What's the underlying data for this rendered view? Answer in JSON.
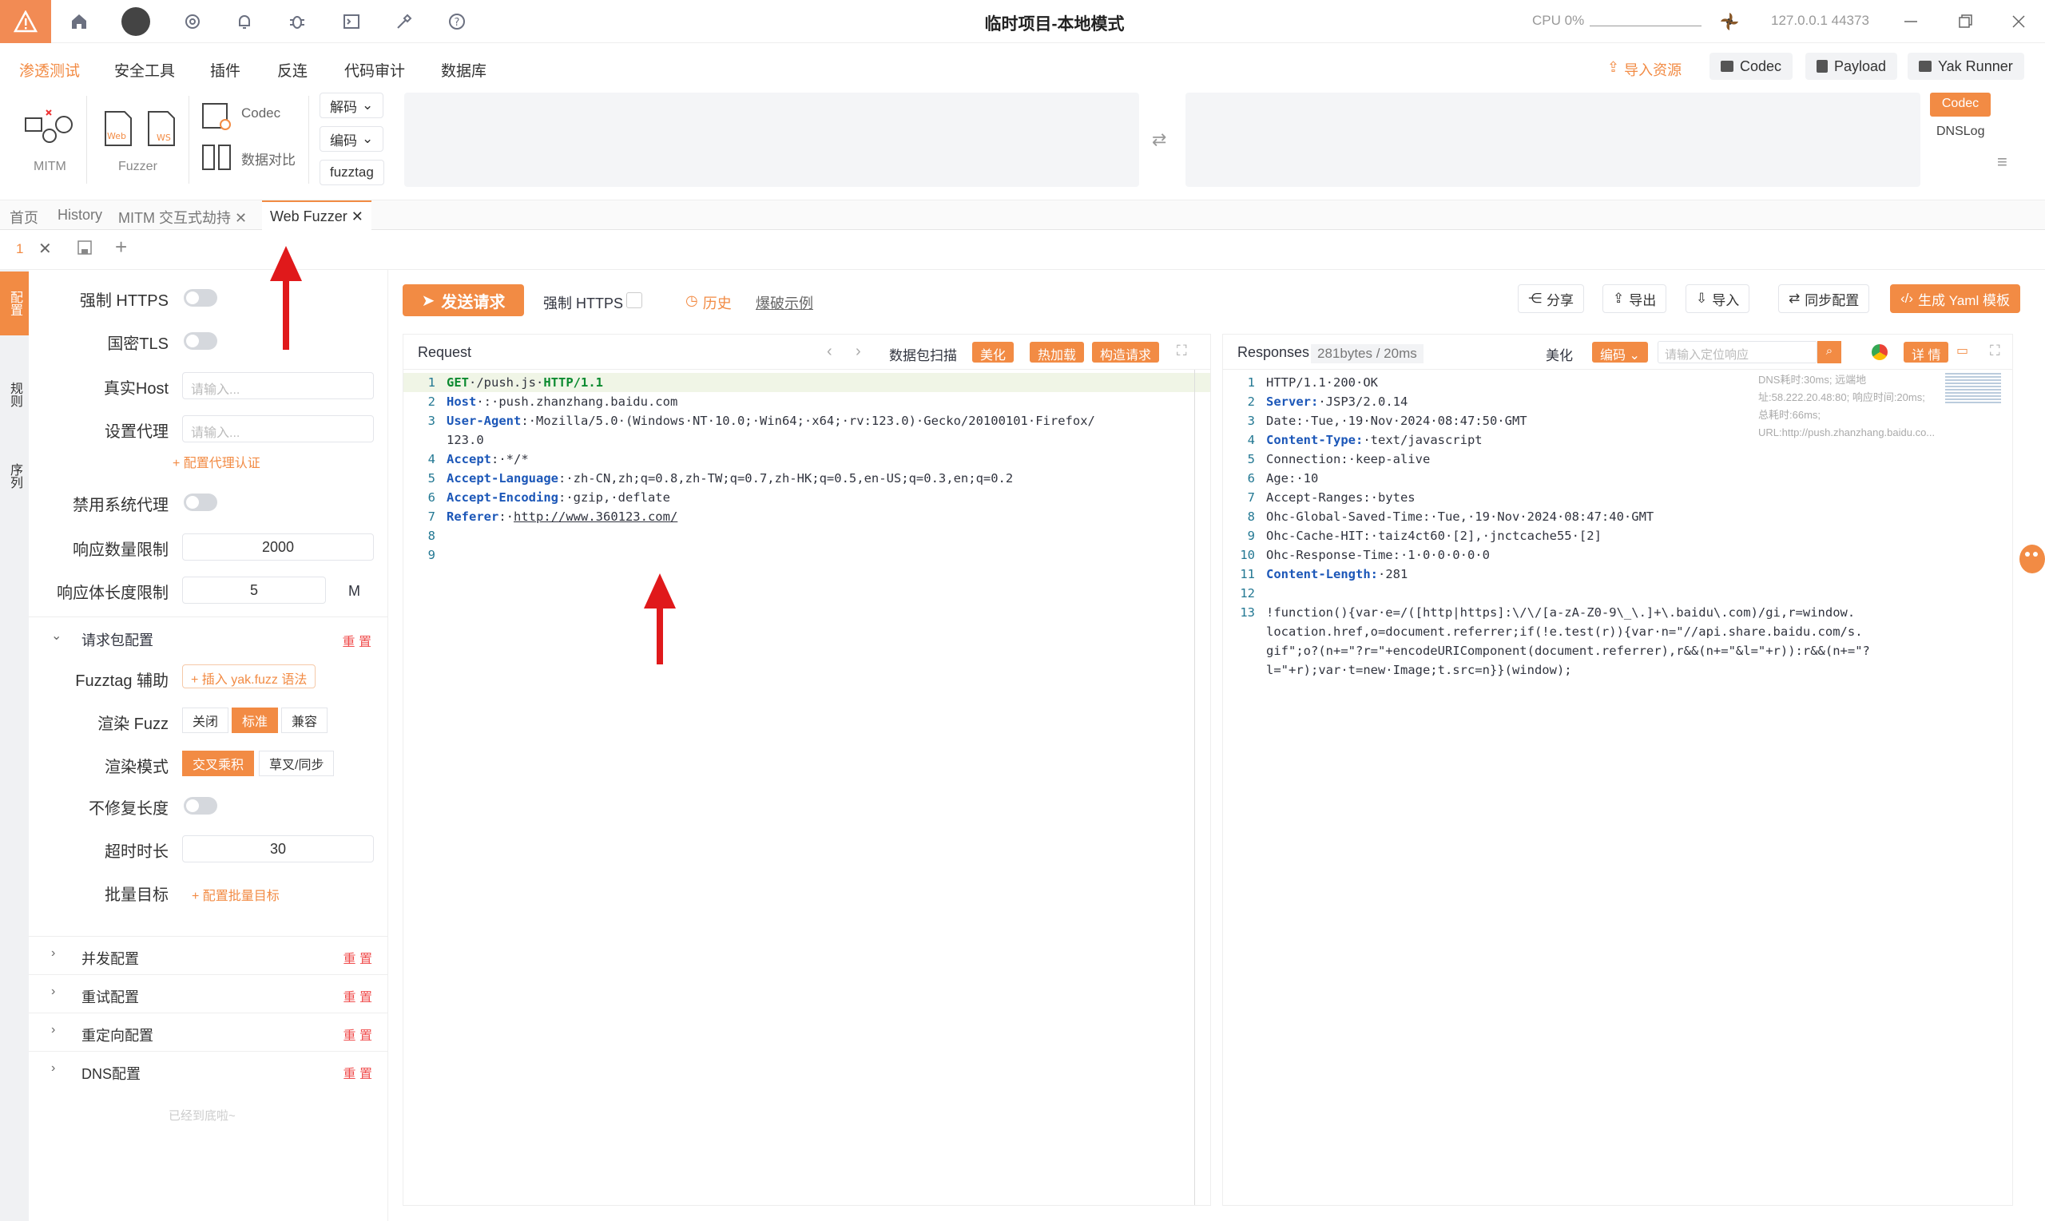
{
  "title": "临时项目-本地模式",
  "cpu": "CPU 0%",
  "ip": "127.0.0.1 44373",
  "menu": [
    "渗透测试",
    "安全工具",
    "插件",
    "反连",
    "代码审计",
    "数据库"
  ],
  "menu_right": {
    "import": "导入资源",
    "codec": "Codec",
    "payload": "Payload",
    "yak": "Yak Runner"
  },
  "tools": {
    "mitm": "MITM",
    "fuzzer": "Fuzzer",
    "codec": "Codec",
    "compare": "数据对比",
    "decode": "解码",
    "encode": "编码",
    "fuzztag": "fuzztag",
    "codec_btn": "Codec",
    "dnslog": "DNSLog"
  },
  "tabs": [
    "首页",
    "History",
    "MITM 交互式劫持",
    "Web Fuzzer"
  ],
  "subtab": "1",
  "left_strip": [
    "配置",
    "规则",
    "序列"
  ],
  "sidebar": {
    "force_https": "强制 HTTPS",
    "gm_tls": "国密TLS",
    "real_host": "真实Host",
    "real_host_ph": "请输入...",
    "proxy": "设置代理",
    "proxy_ph": "请输入...",
    "proxy_auth": "+ 配置代理认证",
    "disable_sys_proxy": "禁用系统代理",
    "resp_count": "响应数量限制",
    "resp_count_val": "2000",
    "resp_len": "响应体长度限制",
    "resp_len_val": "5",
    "resp_len_unit": "M",
    "req_cfg": "请求包配置",
    "reset": "重 置",
    "fuzztag_help": "Fuzztag 辅助",
    "fuzztag_insert": "+ 插入 yak.fuzz 语法",
    "render_fuzz": "渲染 Fuzz",
    "rf_opts": [
      "关闭",
      "标准",
      "兼容"
    ],
    "render_mode": "渲染模式",
    "rm_opts": [
      "交叉乘积",
      "草叉/同步"
    ],
    "no_fix_len": "不修复长度",
    "timeout": "超时时长",
    "timeout_val": "30",
    "batch": "批量目标",
    "batch_link": "+ 配置批量目标",
    "concurrency": "并发配置",
    "retry": "重试配置",
    "redirect": "重定向配置",
    "dns": "DNS配置",
    "bottom": "已经到底啦~"
  },
  "toolbar": {
    "send": "发送请求",
    "force_https": "强制 HTTPS",
    "history": "历史",
    "example": "爆破示例",
    "share": "分享",
    "export": "导出",
    "import": "导入",
    "sync": "同步配置",
    "yaml": "生成 Yaml 模板"
  },
  "request": {
    "title": "Request",
    "scan": "数据包扫描",
    "beautify": "美化",
    "hotload": "热加载",
    "build": "构造请求"
  },
  "response": {
    "title": "Responses",
    "stats": "281bytes / 20ms",
    "beautify": "美化",
    "encode": "编码",
    "search_ph": "请输入定位响应",
    "detail": "详 情",
    "meta": "DNS耗时:30ms; 远端地址:58.222.20.48:80; 响应时间:20ms; 总耗时:66ms; URL:http://push.zhanzhang.baidu.co..."
  },
  "req_lines": [
    {
      "n": "1",
      "parts": [
        [
          "hl",
          "GET"
        ],
        [
          "",
          "·/push.js·"
        ],
        [
          "hl",
          "HTTP/1.1"
        ]
      ]
    },
    {
      "n": "2",
      "parts": [
        [
          "b",
          "Host"
        ],
        [
          "",
          "·:·push.zhanzhang.baidu.com"
        ]
      ]
    },
    {
      "n": "3",
      "parts": [
        [
          "b",
          "User-Agent"
        ],
        [
          "",
          ":·Mozilla/5.0·(Windows·NT·10.0;·Win64;·x64;·rv:123.0)·Gecko/20100101·Firefox/"
        ]
      ]
    },
    {
      "n": "",
      "parts": [
        [
          "",
          "123.0"
        ]
      ]
    },
    {
      "n": "4",
      "parts": [
        [
          "b",
          "Accept"
        ],
        [
          "",
          ":·*/*"
        ]
      ]
    },
    {
      "n": "5",
      "parts": [
        [
          "b",
          "Accept-Language"
        ],
        [
          "",
          ":·zh-CN,zh;q=0.8,zh-TW;q=0.7,zh-HK;q=0.5,en-US;q=0.3,en;q=0.2"
        ]
      ]
    },
    {
      "n": "6",
      "parts": [
        [
          "b",
          "Accept-Encoding"
        ],
        [
          "",
          ":·gzip,·deflate"
        ]
      ]
    },
    {
      "n": "7",
      "parts": [
        [
          "b",
          "Referer"
        ],
        [
          "",
          ":·"
        ],
        [
          "u",
          "http://www.360123.com/"
        ]
      ]
    },
    {
      "n": "8",
      "parts": []
    },
    {
      "n": "9",
      "parts": []
    }
  ],
  "resp_lines": [
    {
      "n": "1",
      "parts": [
        [
          "",
          "HTTP/1.1·200·OK"
        ]
      ]
    },
    {
      "n": "2",
      "parts": [
        [
          "b",
          "Server:"
        ],
        [
          "",
          "·JSP3/2.0.14"
        ]
      ]
    },
    {
      "n": "3",
      "parts": [
        [
          "",
          "Date:·Tue,·19·Nov·2024·08:47:50·GMT"
        ]
      ]
    },
    {
      "n": "4",
      "parts": [
        [
          "b",
          "Content-Type:"
        ],
        [
          "",
          "·text/javascript"
        ]
      ]
    },
    {
      "n": "5",
      "parts": [
        [
          "",
          "Connection:·keep-alive"
        ]
      ]
    },
    {
      "n": "6",
      "parts": [
        [
          "",
          "Age:·10"
        ]
      ]
    },
    {
      "n": "7",
      "parts": [
        [
          "",
          "Accept-Ranges:·bytes"
        ]
      ]
    },
    {
      "n": "8",
      "parts": [
        [
          "",
          "Ohc-Global-Saved-Time:·Tue,·19·Nov·2024·08:47:40·GMT"
        ]
      ]
    },
    {
      "n": "9",
      "parts": [
        [
          "",
          "Ohc-Cache-HIT:·taiz4ct60·[2],·jnctcache55·[2]"
        ]
      ]
    },
    {
      "n": "10",
      "parts": [
        [
          "",
          "Ohc-Response-Time:·1·0·0·0·0·0"
        ]
      ]
    },
    {
      "n": "11",
      "parts": [
        [
          "b",
          "Content-Length:"
        ],
        [
          "",
          "·281"
        ]
      ]
    },
    {
      "n": "12",
      "parts": []
    },
    {
      "n": "13",
      "parts": [
        [
          "",
          "!function(){var·e=/([http|https]:\\/\\/[a-zA-Z0-9\\_\\.]+\\.baidu\\.com)/gi,r=window."
        ]
      ]
    },
    {
      "n": "",
      "parts": [
        [
          "",
          "location.href,o=document.referrer;if(!e.test(r)){var·n=\"//api.share.baidu.com/s."
        ]
      ]
    },
    {
      "n": "",
      "parts": [
        [
          "",
          "gif\";o?(n+=\"?r=\"+encodeURIComponent(document.referrer),r&&(n+=\"&l=\"+r)):r&&(n+=\"?"
        ]
      ]
    },
    {
      "n": "",
      "parts": [
        [
          "",
          "l=\"+r);var·t=new·Image;t.src=n}}(window);"
        ]
      ]
    }
  ],
  "accent": "#f28b44"
}
